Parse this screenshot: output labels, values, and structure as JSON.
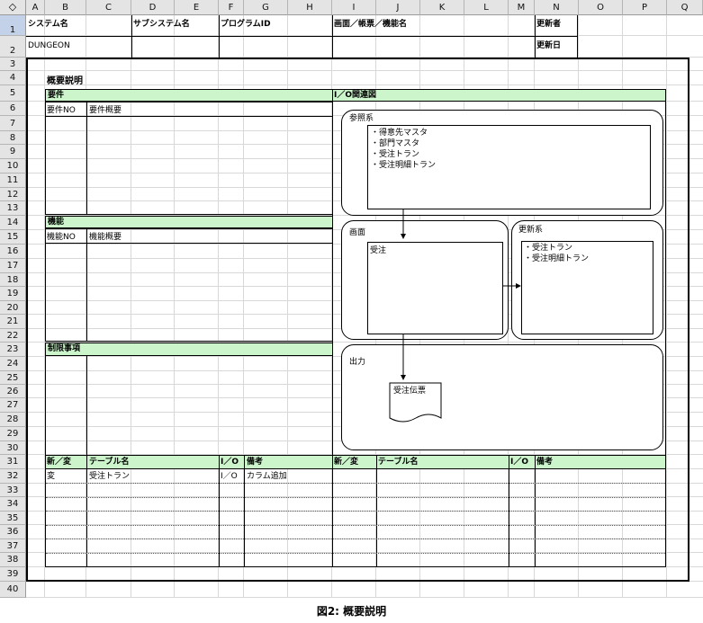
{
  "columns": [
    "A",
    "B",
    "C",
    "D",
    "E",
    "F",
    "G",
    "H",
    "I",
    "J",
    "K",
    "L",
    "M",
    "N",
    "O",
    "P",
    "Q"
  ],
  "rows": [
    "1",
    "2",
    "3",
    "4",
    "5",
    "6",
    "7",
    "8",
    "9",
    "10",
    "11",
    "12",
    "13",
    "14",
    "15",
    "16",
    "17",
    "18",
    "19",
    "20",
    "21",
    "22",
    "23",
    "24",
    "25",
    "26",
    "27",
    "28",
    "29",
    "30",
    "31",
    "32",
    "33",
    "34",
    "35",
    "36",
    "37",
    "38",
    "39",
    "40"
  ],
  "corner_icon": "diamond-icon",
  "header": {
    "system_label": "システム名",
    "subsystem_label": "サブシステム名",
    "program_label": "プログラムID",
    "screen_label": "画面／帳票／機能名",
    "updater_label": "更新者",
    "system_value": "DUNGEON",
    "updated_label": "更新日"
  },
  "doc": {
    "title": "概要説明",
    "requirements_label": "要件",
    "req_no": "要件NO",
    "req_summary": "要件概要",
    "function_label": "機能",
    "func_no": "機能NO",
    "func_summary": "機能概要",
    "restrictions_label": "制限事項",
    "io_diagram_label": "I／O関連図"
  },
  "diagram": {
    "reference_label": "参照系",
    "reference_items": [
      "・得意先マスタ",
      "・部門マスタ",
      "・受注トラン",
      "・受注明細トラン"
    ],
    "screen_label": "画面",
    "screen_item": "受注",
    "update_label": "更新系",
    "update_items": [
      "・受注トラン",
      "・受注明細トラン"
    ],
    "output_label": "出力",
    "output_item": "受注伝票"
  },
  "tables": {
    "left_headers": [
      "新／変",
      "テーブル名",
      "I／O",
      "備考"
    ],
    "right_headers": [
      "新／変",
      "テーブル名",
      "I／O",
      "備考"
    ],
    "left_rows": [
      [
        "変",
        "受注トラン",
        "I／O",
        "カラム追加"
      ]
    ]
  },
  "caption": "図2: 概要説明"
}
